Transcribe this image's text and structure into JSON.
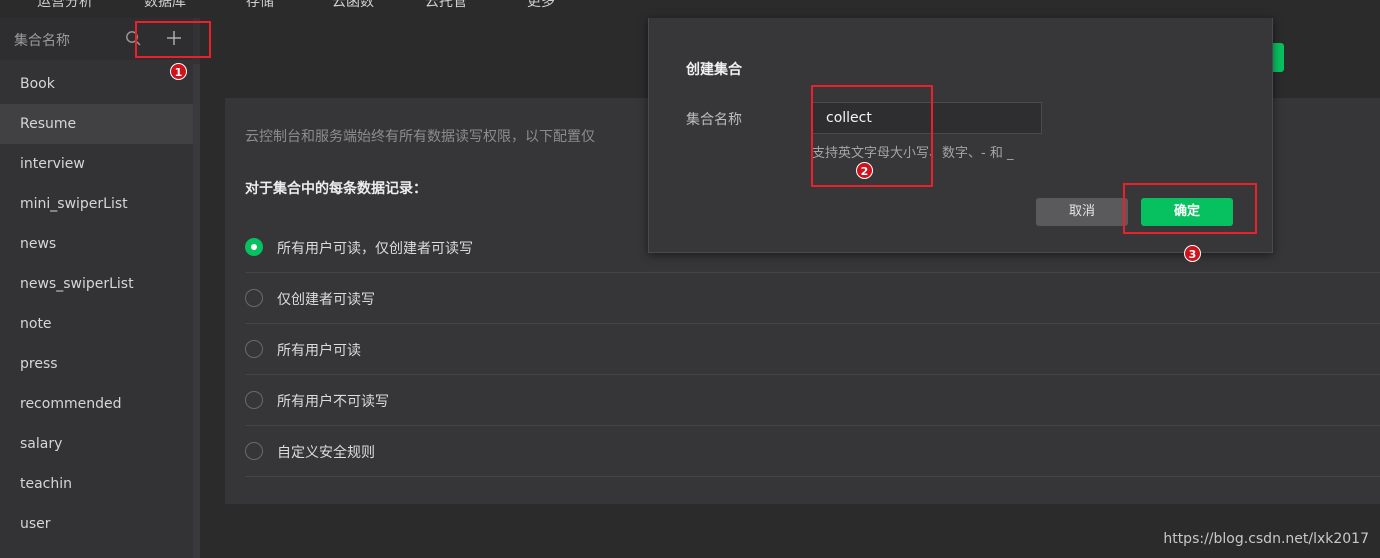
{
  "top_tabs": [
    "运营分析",
    "数据库",
    "存储",
    "云函数",
    "云托管",
    "更多"
  ],
  "sidebar": {
    "title": "集合名称",
    "items": [
      {
        "label": "Book"
      },
      {
        "label": "Resume"
      },
      {
        "label": "interview"
      },
      {
        "label": "mini_swiperList"
      },
      {
        "label": "news"
      },
      {
        "label": "news_swiperList"
      },
      {
        "label": "note"
      },
      {
        "label": "press"
      },
      {
        "label": "recommended"
      },
      {
        "label": "salary"
      },
      {
        "label": "teachin"
      },
      {
        "label": "user"
      }
    ],
    "active_item": "Resume"
  },
  "panel": {
    "intro": "云控制台和服务端始终有所有数据读写权限，以下配置仅",
    "subhead": "对于集合中的每条数据记录：",
    "options": [
      {
        "label": "所有用户可读，仅创建者可读写",
        "selected": true
      },
      {
        "label": "仅创建者可读写",
        "selected": false
      },
      {
        "label": "所有用户可读",
        "selected": false
      },
      {
        "label": "所有用户不可读写",
        "selected": false
      },
      {
        "label": "自定义安全规则",
        "selected": false
      }
    ]
  },
  "dialog": {
    "title": "创建集合",
    "field_label": "集合名称",
    "field_value": "collect",
    "hint": "支持英文字母大小写、数字、- 和 _",
    "cancel_label": "取消",
    "ok_label": "确定"
  },
  "annotations": [
    "1",
    "2",
    "3"
  ],
  "watermark": "https://blog.csdn.net/lxk2017",
  "colors": {
    "accent": "#07c160",
    "annotation": "#e8212a",
    "background": "#2b2b2c",
    "sidebar": "#333335"
  }
}
